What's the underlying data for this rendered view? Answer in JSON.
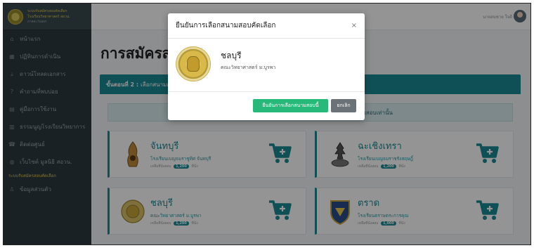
{
  "sidebar": {
    "brand_line1": "ระบบรับสมัครสอบคัดเลือก",
    "brand_line2": "โรงเรียนวิทยาศาสตร์ สอวน.",
    "brand_line3": "ภาคตะวันออก",
    "items": [
      {
        "label": "หน้าแรก",
        "icon": "home-icon"
      },
      {
        "label": "ปฏิทินการดำเนิน",
        "icon": "calendar-icon"
      },
      {
        "label": "ดาวน์โหลดเอกสาร",
        "icon": "download-icon"
      },
      {
        "label": "คำถามที่พบบ่อย",
        "icon": "question-icon"
      },
      {
        "label": "คู่มือการใช้งาน",
        "icon": "book-icon"
      },
      {
        "label": "ธรรมนูญโรงเรียนวิทยาการ",
        "icon": "document-icon"
      },
      {
        "label": "ติดต่อศูนย์",
        "icon": "phone-icon"
      },
      {
        "label": "เว็บไซต์ มูลนิธิ สอวน.",
        "icon": "globe-icon"
      }
    ],
    "section_label": "ระบบรับสมัครสอบคัดเลือก",
    "profile_item": {
      "label": "ข้อมูลส่วนตัว",
      "icon": "user-icon"
    }
  },
  "topbar": {
    "user_name": "นายสมชาย ใจดี"
  },
  "main": {
    "page_title": "การสมัครสอบ",
    "step_label": "ขั้นตอนที่ 2 :",
    "step_text": "เลือกสนามสอบ",
    "info_text": "เลือกได้ 1 สนามสอบเท่านั้น"
  },
  "cards": [
    {
      "name": "จันทบุรี",
      "place": "โรงเรียนเบญจมราชูทิศ จันทบุรี",
      "seats_prefix": "เหลือที่นั่งสอบ",
      "seats": "1,200",
      "seats_suffix": "ที่นั่ง"
    },
    {
      "name": "ฉะเชิงเทรา",
      "place": "โรงเรียนเบญจมราชรังสฤษฎิ์",
      "seats_prefix": "เหลือที่นั่งสอบ",
      "seats": "1,200",
      "seats_suffix": "ที่นั่ง"
    },
    {
      "name": "ชลบุรี",
      "place": "คณะวิทยาศาสตร์ ม.บูรพา",
      "seats_prefix": "เหลือที่นั่งสอบ",
      "seats": "1,200",
      "seats_suffix": "ที่นั่ง"
    },
    {
      "name": "ตราด",
      "place": "โรงเรียนตราษตระการคุณ",
      "seats_prefix": "เหลือที่นั่งสอบ",
      "seats": "1,000",
      "seats_suffix": "ที่นั่ง"
    }
  ],
  "modal": {
    "title": "ยืนยันการเลือกสนามสอบคัดเลือก",
    "close_symbol": "×",
    "venue_name": "ชลบุรี",
    "venue_faculty": "คณะวิทยาศาสตร์ ม.บูรพา",
    "confirm_label": "ยืนยันการเลือกสนามสอบนี้",
    "cancel_label": "ยกเลิก"
  },
  "colors": {
    "accent": "#1b8a94",
    "confirm": "#27b97a",
    "cancel": "#6c7378",
    "sidebar": "#2e3a3f"
  }
}
